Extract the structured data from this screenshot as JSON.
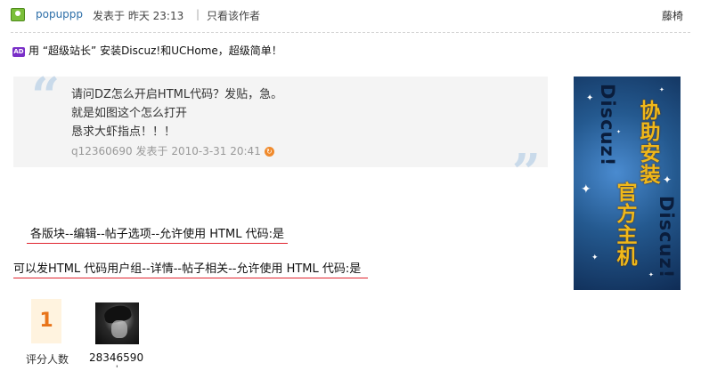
{
  "post_header": {
    "author": "popuppp",
    "posted_text": "发表于  昨天 23:13",
    "separator": "|",
    "only_author_link": "只看该作者",
    "floor_label": "藤椅"
  },
  "ad": {
    "badge": "AD",
    "text": "用 “超级站长” 安装Discuz!和UCHome，超级简单！"
  },
  "quote": {
    "lines": [
      "请问DZ怎么开启HTML代码？发贴，急。",
      "就是如图这个怎么打开",
      "恳求大虾指点！！！"
    ],
    "meta": "q12360690 发表于  2010-3-31 20:41"
  },
  "body": {
    "line1": "各版块--编辑--帖子选项--允许使用 HTML 代码:是",
    "line2": "可以发HTML 代码用户组--详情--帖子相关--允许使用 HTML 代码:是"
  },
  "banner": {
    "col_a": "Discuz!",
    "col_b": "官方主机",
    "col_b_top": "协助安装",
    "col_c": "Discuz!"
  },
  "rating": {
    "count": "1",
    "count_label": "评分人数",
    "rater_name": "28346590",
    "rater_tick": "'"
  },
  "colors": {
    "link": "#2c6ea8",
    "underline": "#e0242e",
    "rating_orange": "#e8741a"
  }
}
